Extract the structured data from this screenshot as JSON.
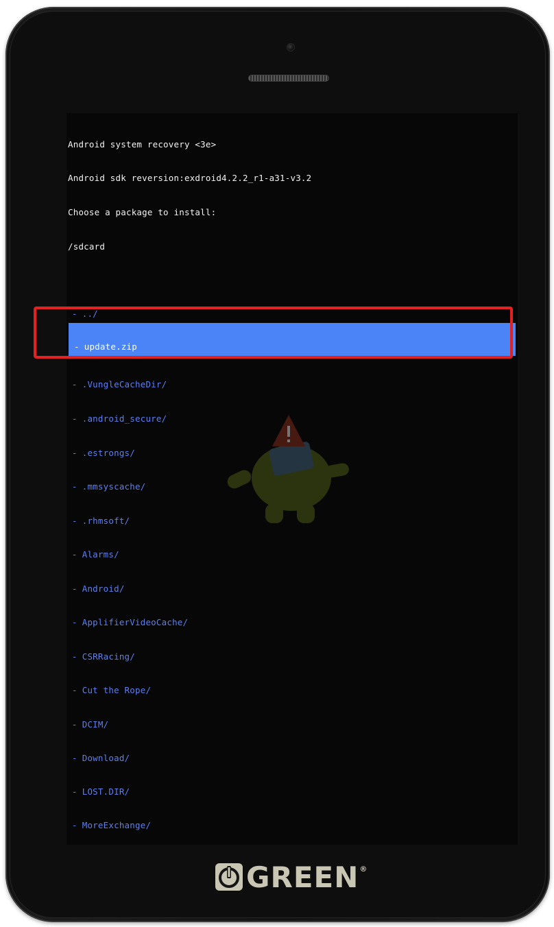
{
  "recovery": {
    "title": "Android system recovery <3e>",
    "sdk": "Android sdk reversion:exdroid4.2.2_r1-a31-v3.2",
    "prompt": "Choose a package to install:",
    "path": "/sdcard"
  },
  "files": [
    {
      "name": "../",
      "selected": false
    },
    {
      "name": "update.zip",
      "selected": true
    },
    {
      "name": ".VungleCacheDir/",
      "selected": false
    },
    {
      "name": ".android_secure/",
      "selected": false
    },
    {
      "name": ".estrongs/",
      "selected": false
    },
    {
      "name": ".mmsyscache/",
      "selected": false
    },
    {
      "name": ".rhmsoft/",
      "selected": false
    },
    {
      "name": "Alarms/",
      "selected": false
    },
    {
      "name": "Android/",
      "selected": false
    },
    {
      "name": "ApplifierVideoCache/",
      "selected": false
    },
    {
      "name": "CSRRacing/",
      "selected": false
    },
    {
      "name": "Cut the Rope/",
      "selected": false
    },
    {
      "name": "DCIM/",
      "selected": false
    },
    {
      "name": "Download/",
      "selected": false
    },
    {
      "name": "LOST.DIR/",
      "selected": false
    },
    {
      "name": "MoreExchange/",
      "selected": false
    }
  ],
  "brand": {
    "name": "GREEN",
    "registered": "®"
  },
  "colors": {
    "selection": "#4a84f7",
    "file_text": "#5d7ff0",
    "header_text": "#f2f2f2",
    "annotation": "#e32121"
  }
}
